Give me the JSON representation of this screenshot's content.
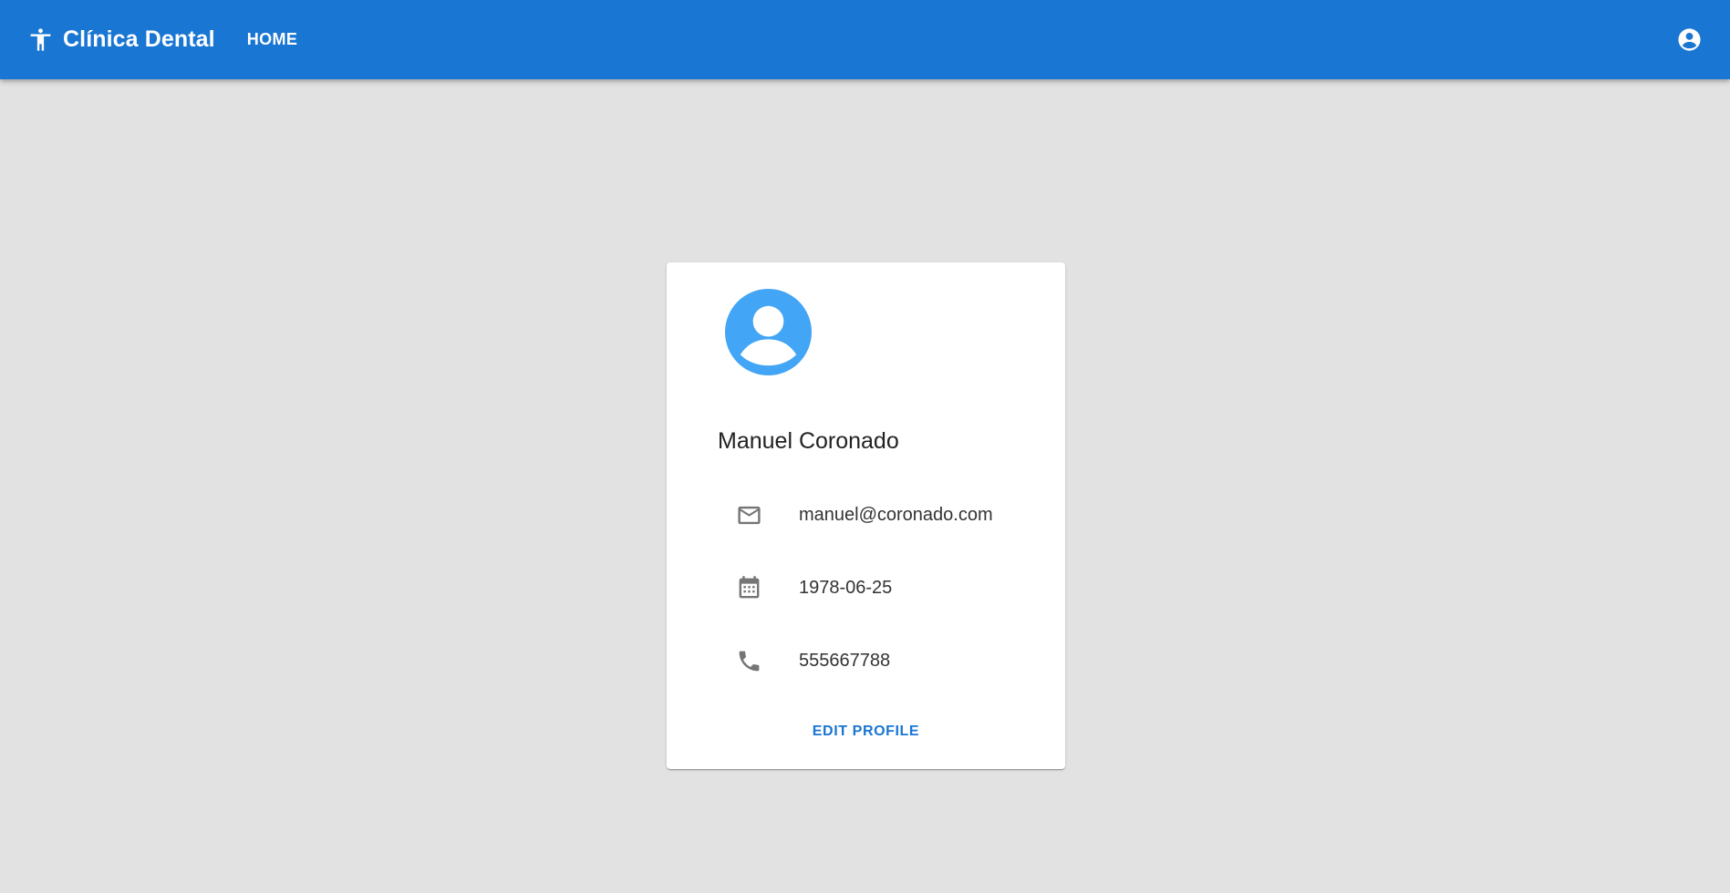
{
  "header": {
    "brand_title": "Clínica Dental",
    "brand_icon": "accessibility-icon",
    "nav_home": "HOME",
    "account_icon": "account-circle-icon",
    "background_color": "#1976d2"
  },
  "profile": {
    "avatar_icon": "avatar-icon",
    "avatar_color": "#42a5f5",
    "name": "Manuel Coronado",
    "email_icon": "mail-icon",
    "email": "manuel@coronado.com",
    "birthdate_icon": "calendar-icon",
    "birthdate": "1978-06-25",
    "phone_icon": "phone-icon",
    "phone": "555667788",
    "edit_label": "EDIT PROFILE",
    "accent_color": "#1976d2"
  }
}
